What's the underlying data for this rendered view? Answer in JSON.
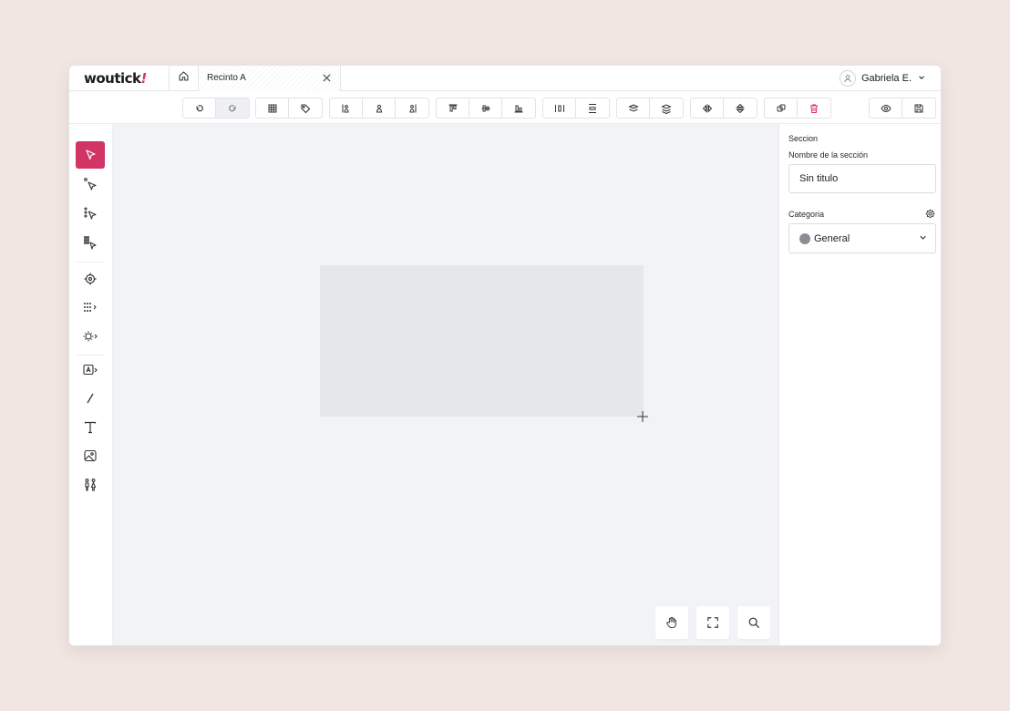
{
  "app": {
    "logo_text": "woutick",
    "logo_mark": "!"
  },
  "topbar": {
    "home_icon": "home-icon",
    "tab_label": "Recinto A",
    "close_icon": "close-icon",
    "user_name": "Gabriela E.",
    "user_icon": "user-icon",
    "chevron_icon": "chevron-down-icon"
  },
  "toolbar": {
    "groups": [
      [
        "undo-icon",
        "redo-icon"
      ],
      [
        "grid-icon",
        "tag-icon"
      ],
      [
        "align-left-person-icon",
        "person-icon",
        "align-right-person-icon"
      ],
      [
        "align-top-icon",
        "align-middle-icon",
        "align-bottom-icon"
      ],
      [
        "distribute-horizontal-icon",
        "distribute-vertical-icon"
      ],
      [
        "bring-forward-icon",
        "send-backward-icon"
      ],
      [
        "flip-horizontal-icon",
        "flip-vertical-icon"
      ],
      [
        "duplicate-icon",
        "delete-icon"
      ],
      [
        "preview-icon",
        "save-icon"
      ]
    ],
    "active": "redo-icon"
  },
  "rail": {
    "tools": [
      "select-icon",
      "select-node-icon",
      "select-row-icon",
      "select-group-icon",
      "target-icon",
      "seat-grid-icon",
      "table-icon",
      "text-area-icon",
      "line-icon",
      "text-icon",
      "image-icon",
      "restroom-icon"
    ],
    "active": "select-icon"
  },
  "canvas": {
    "hand_icon": "hand-icon",
    "fullscreen_icon": "fullscreen-icon",
    "search_icon": "search-icon"
  },
  "panel": {
    "title": "Seccion",
    "name_label": "Nombre de la sección",
    "name_value": "Sin titulo",
    "category_label": "Categoria",
    "category_value": "General",
    "category_color": "#8a8f95",
    "settings_icon": "gear-icon"
  },
  "colors": {
    "accent": "#d13465",
    "canvas_bg": "#f2f3f7",
    "section_fill": "#e5e7eb"
  }
}
